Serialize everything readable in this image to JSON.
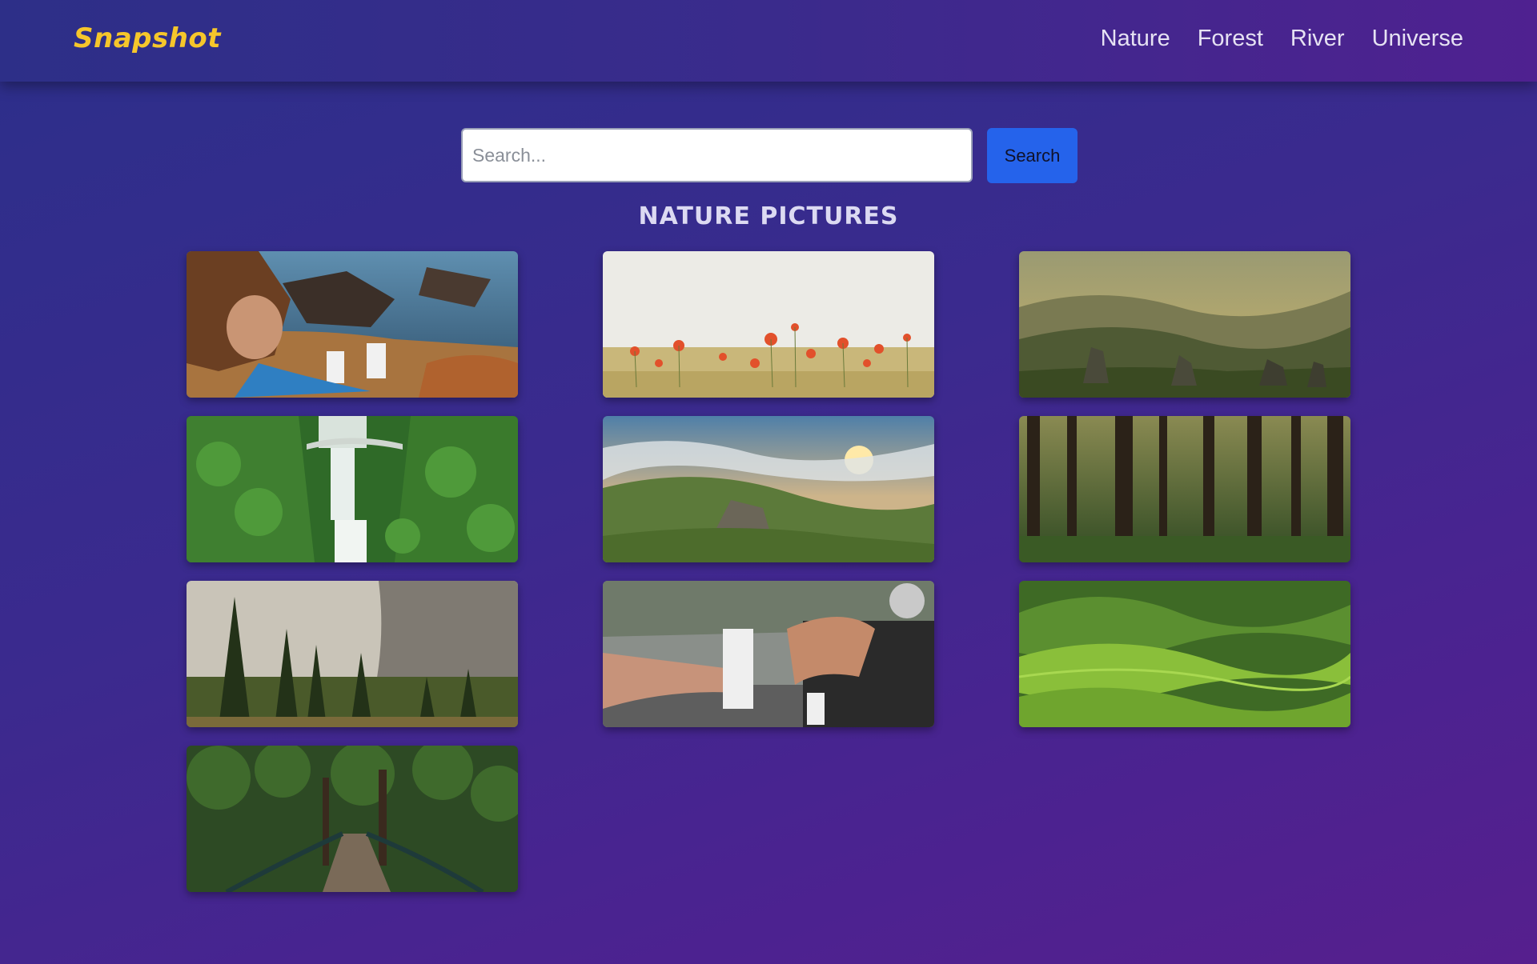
{
  "brand": "Snapshot",
  "nav": {
    "items": [
      {
        "label": "Nature"
      },
      {
        "label": "Forest"
      },
      {
        "label": "River"
      },
      {
        "label": "Universe"
      }
    ]
  },
  "search": {
    "placeholder": "Search...",
    "value": "",
    "button_label": "Search"
  },
  "gallery": {
    "heading": "NATURE PICTURES",
    "photos": [
      {
        "depicts": "people-holding-water-cartons-on-coastal-cliff"
      },
      {
        "depicts": "red-poppy-field"
      },
      {
        "depicts": "misty-mountain-valley-with-rocks"
      },
      {
        "depicts": "waterfall-with-bridge"
      },
      {
        "depicts": "green-hills-under-sunset-clouds"
      },
      {
        "depicts": "tall-forest-trees"
      },
      {
        "depicts": "pine-trees-and-granite-cliff"
      },
      {
        "depicts": "two-people-sitting-with-water-cartons"
      },
      {
        "depicts": "rolling-green-hills"
      },
      {
        "depicts": "wooden-bridge-in-forest"
      }
    ]
  }
}
